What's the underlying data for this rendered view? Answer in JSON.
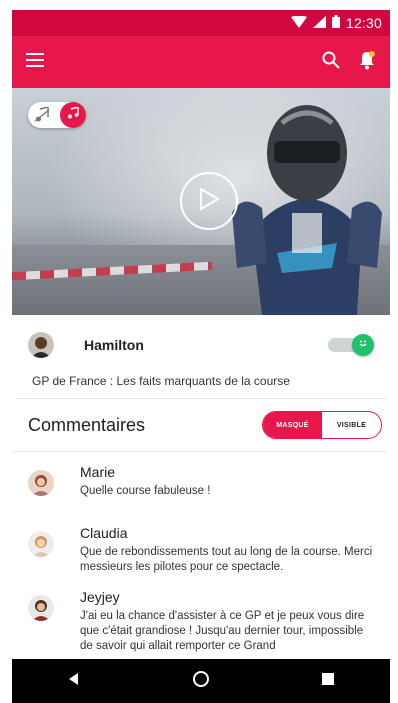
{
  "status_bar": {
    "time": "12:30"
  },
  "app_bar": {
    "menu_icon": "hamburger-icon",
    "search_icon": "search-icon",
    "notification_icon": "bell-icon"
  },
  "colors": {
    "primary": "#e8174b",
    "status_bar": "#d1083f",
    "switch_on": "#1fc26a"
  },
  "video": {
    "sound_toggle": {
      "off_icon": "music-off-icon",
      "on_icon": "music-note-icon",
      "state": "on"
    },
    "play_icon": "play-icon"
  },
  "driver": {
    "name": "Hamilton",
    "follow_switch": "on"
  },
  "video_title": "GP de France : Les faits marquants de la course",
  "comments": {
    "title": "Commentaires",
    "filter": {
      "masque_label": "MASQUÉ",
      "visible_label": "VISIBLE",
      "selected": "VISIBLE"
    },
    "items": [
      {
        "author": "Marie",
        "text": "Quelle course fabuleuse !"
      },
      {
        "author": "Claudia",
        "text": "Que de rebondissements tout au long de la course. Merci messieurs les pilotes pour ce spectacle."
      },
      {
        "author": "Jeyjey",
        "text": "J'ai eu la chance d'assister à ce GP et je peux vous dire que c'était grandiose ! Jusqu'au dernier tour, impossible de savoir qui allait remporter ce Grand"
      }
    ]
  },
  "nav_bar": {
    "back_icon": "back-triangle-icon",
    "home_icon": "home-circle-icon",
    "recents_icon": "recents-square-icon"
  }
}
